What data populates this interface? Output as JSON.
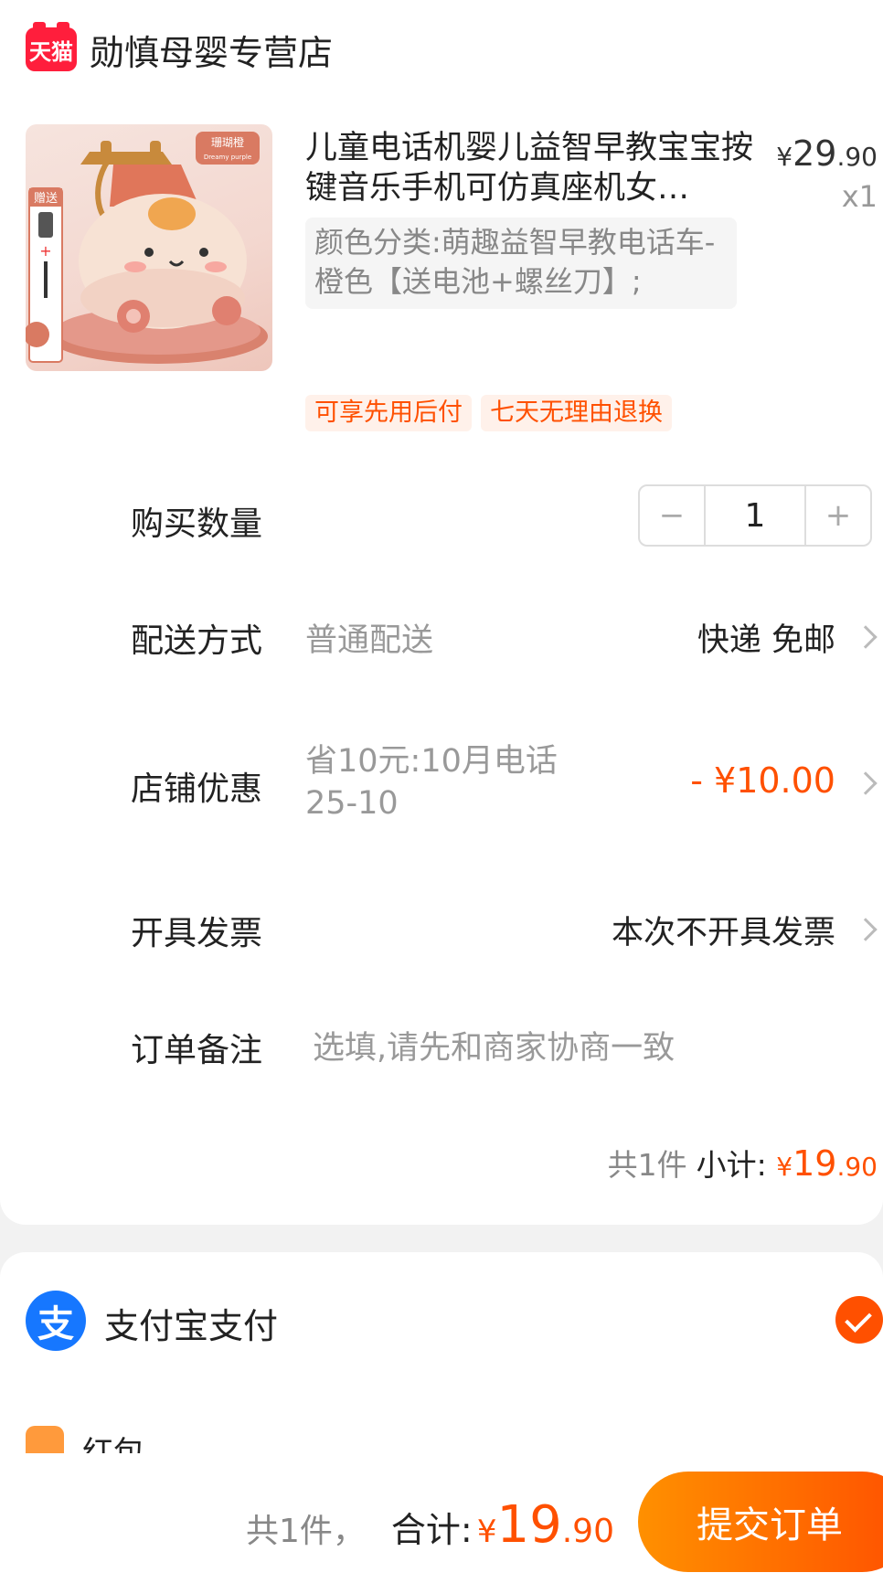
{
  "store": {
    "badge": "天猫",
    "name": "勋慎母婴专营店"
  },
  "product": {
    "title": "儿童电话机婴儿益智早教宝宝按键音乐手机可仿真座机女…",
    "price_currency": "¥",
    "price_int": "29",
    "price_dec": ".90",
    "quantity_label": "x1",
    "sku": "颜色分类:萌趣益智早教电话车-橙色【送电池+螺丝刀】;",
    "tags": [
      "可享先用后付",
      "七天无理由退换"
    ],
    "image": {
      "brand": "珊瑚橙",
      "gift": "赠送"
    }
  },
  "quantity": {
    "label": "购买数量",
    "value": "1",
    "minus": "−",
    "plus": "+"
  },
  "delivery": {
    "label": "配送方式",
    "type": "普通配送",
    "value": "快递 免邮"
  },
  "discount": {
    "label": "店铺优惠",
    "desc": "省10元:10月电话25-10",
    "value": "- ¥10.00"
  },
  "invoice": {
    "label": "开具发票",
    "value": "本次不开具发票"
  },
  "remark": {
    "label": "订单备注",
    "placeholder": "选填,请先和商家协商一致"
  },
  "subtotal": {
    "count": "共1件",
    "label": "小计:",
    "currency": "¥",
    "int": "19",
    "dec": ".90"
  },
  "payment": {
    "icon_char": "支",
    "method": "支付宝支付",
    "selected": true,
    "next_label": "红包"
  },
  "footer": {
    "count": "共1件，",
    "label": "合计:",
    "currency": "¥",
    "int": "19",
    "dec": ".90",
    "submit": "提交订单"
  },
  "colors": {
    "accent": "#ff5000",
    "tmall": "#ff1e3c",
    "alipay": "#1677ff"
  }
}
